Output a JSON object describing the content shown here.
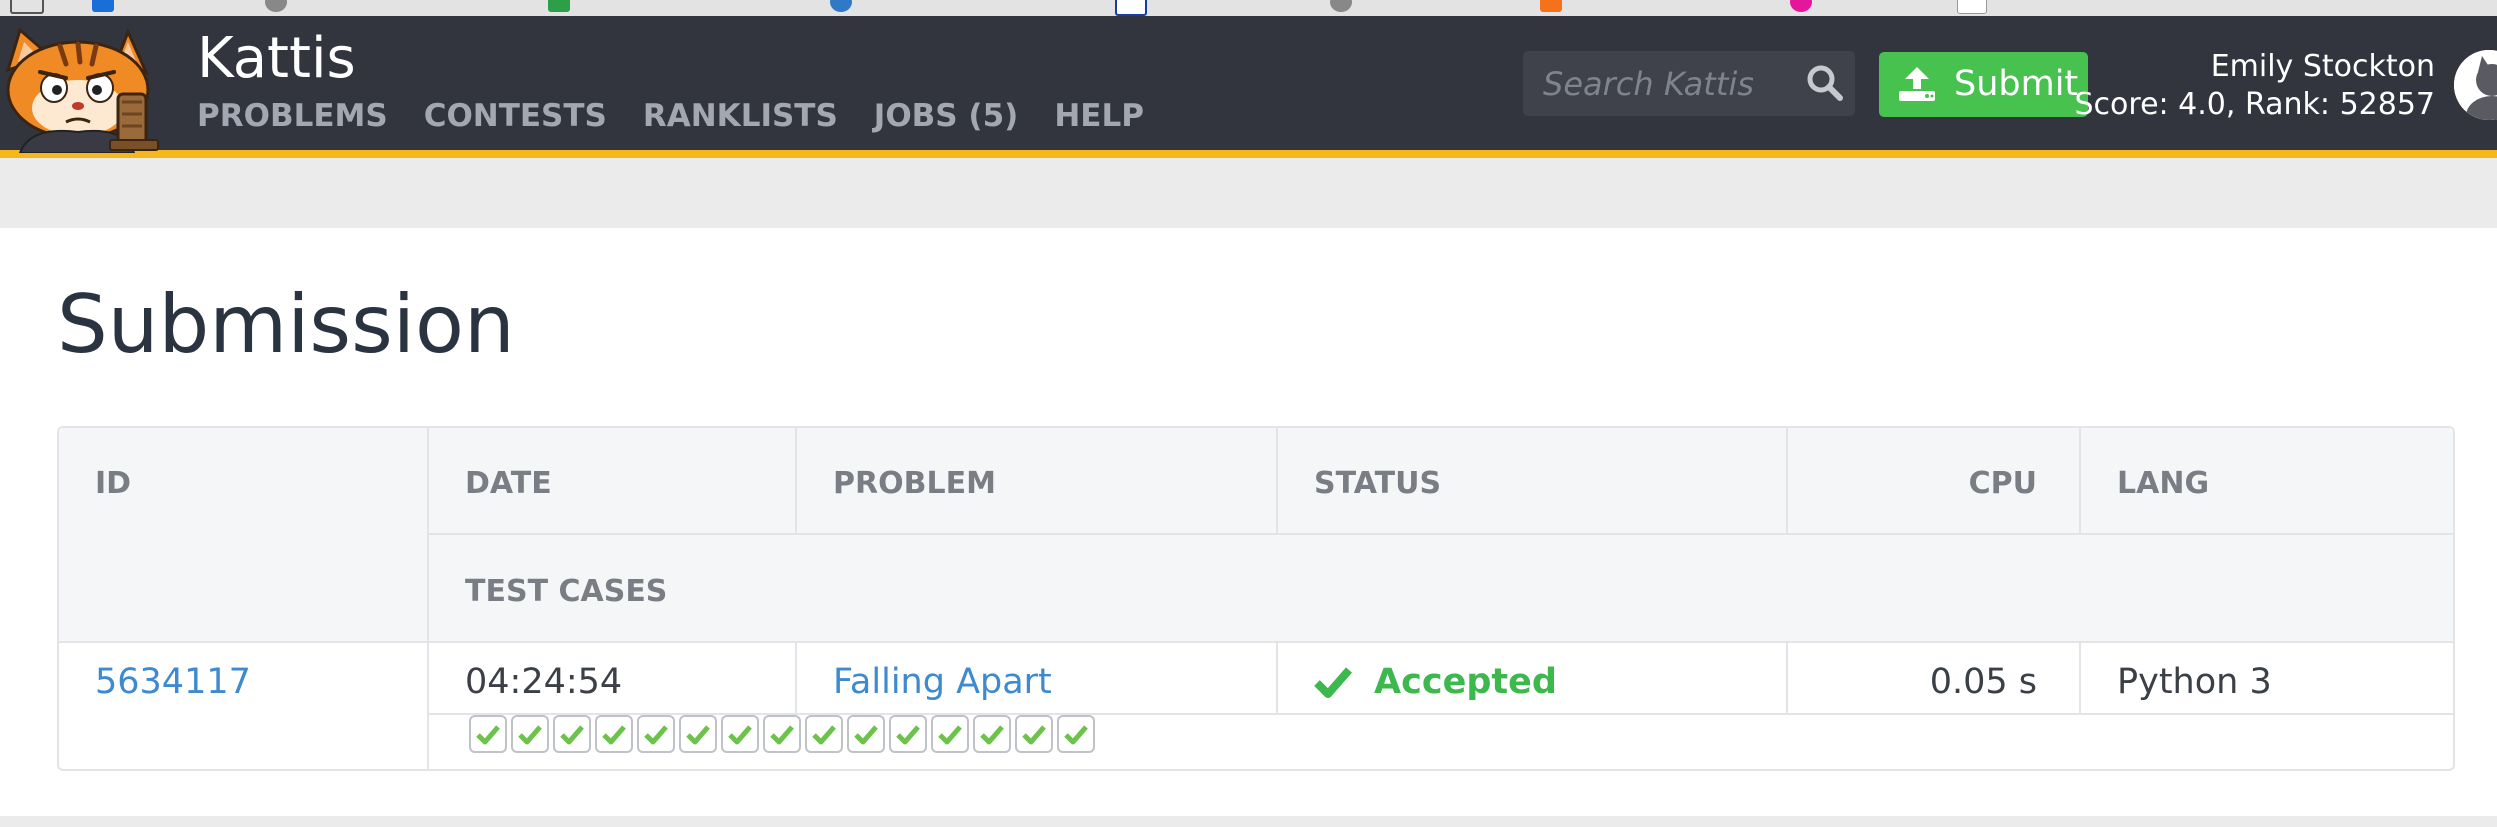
{
  "header": {
    "site_title": "Kattis",
    "nav": [
      {
        "label": "PROBLEMS"
      },
      {
        "label": "CONTESTS"
      },
      {
        "label": "RANKLISTS"
      },
      {
        "label": "JOBS (5)"
      },
      {
        "label": "HELP"
      }
    ],
    "search": {
      "placeholder": "Search Kattis"
    },
    "submit_label": "Submit",
    "user": {
      "name": "Emily Stockton",
      "score_rank": "Score: 4.0, Rank: 52857"
    }
  },
  "page": {
    "title": "Submission"
  },
  "table": {
    "columns": {
      "id": "ID",
      "date": "DATE",
      "problem": "PROBLEM",
      "status": "STATUS",
      "cpu": "CPU",
      "lang": "LANG",
      "test_cases": "TEST CASES"
    },
    "row": {
      "id": "5634117",
      "date": "04:24:54",
      "problem": "Falling Apart",
      "status": "Accepted",
      "cpu": "0.05 s",
      "lang": "Python 3"
    },
    "test_cases": [
      "accepted",
      "accepted",
      "accepted",
      "accepted",
      "accepted",
      "accepted",
      "accepted",
      "accepted",
      "accepted",
      "accepted",
      "accepted",
      "accepted",
      "accepted",
      "accepted",
      "accepted"
    ]
  },
  "colors": {
    "header_bg": "#33353e",
    "accent_stripe": "#f4b81c",
    "submit_green": "#47c24f",
    "link_blue": "#3d8ad1",
    "accepted_green": "#3cb84c"
  },
  "icons": [
    "kattis-logo",
    "search-icon",
    "upload-icon",
    "avatar",
    "check-icon"
  ]
}
